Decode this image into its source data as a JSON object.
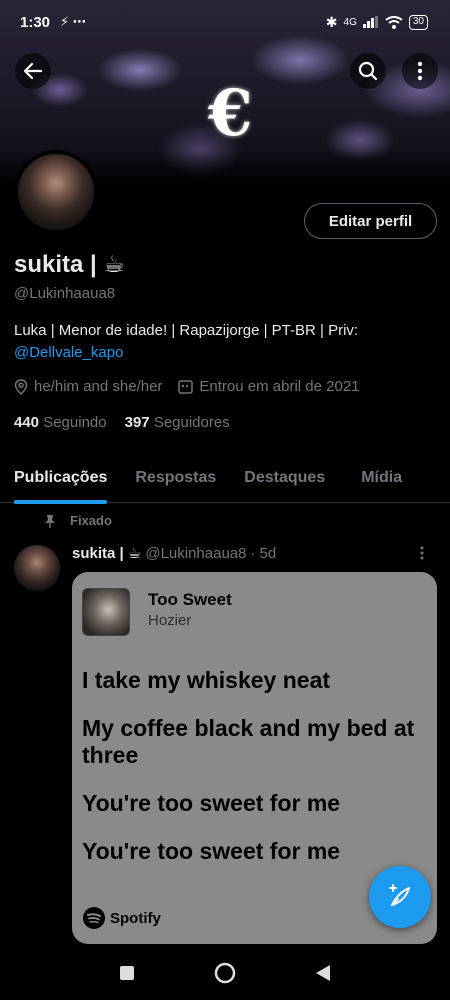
{
  "status_bar": {
    "time": "1:30",
    "network": "4G",
    "battery": "30"
  },
  "profile": {
    "display_name": "sukita | ☕",
    "handle": "@Lukinhaaua8",
    "bio_text": "Luka | Menor de idade! | Rapazijorge | PT-BR | Priv: ",
    "bio_link": "@Dellvale_kapo",
    "pronouns": "he/him and she/her",
    "joined": "Entrou em abril de 2021",
    "following_count": "440",
    "following_label": "Seguindo",
    "followers_count": "397",
    "followers_label": "Seguidores",
    "edit_button": "Editar perfil"
  },
  "tabs": [
    {
      "label": "Publicações",
      "active": true
    },
    {
      "label": "Respostas",
      "active": false
    },
    {
      "label": "Destaques",
      "active": false
    },
    {
      "label": "Mídia",
      "active": false
    }
  ],
  "pinned_label": "Fixado",
  "tweet": {
    "name": "sukita | ☕",
    "handle": "@Lukinhaaua8",
    "separator": "·",
    "time": "5d",
    "card": {
      "song_title": "Too Sweet",
      "artist": "Hozier",
      "lyrics": [
        "I take my whiskey neat",
        "My coffee black and my bed at three",
        "You're too sweet for me",
        "You're too sweet for me"
      ],
      "brand": "Spotify"
    }
  },
  "colors": {
    "accent": "#1d9bf0",
    "muted": "#71767b",
    "card_bg": "#8a8a8a"
  }
}
